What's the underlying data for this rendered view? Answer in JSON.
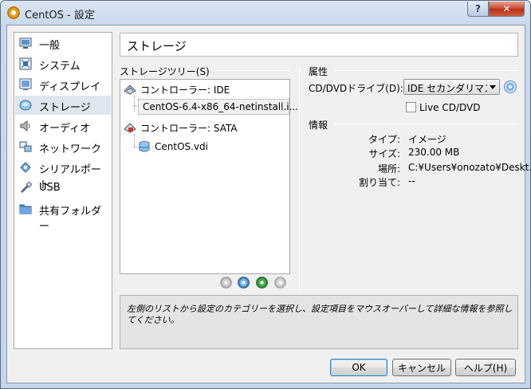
{
  "window": {
    "title": "CentOS - 設定",
    "help_button": "?",
    "close_button": "✕"
  },
  "nav": {
    "items": [
      {
        "label": "一般",
        "icon": "general-icon"
      },
      {
        "label": "システム",
        "icon": "system-icon"
      },
      {
        "label": "ディスプレイ",
        "icon": "display-icon"
      },
      {
        "label": "ストレージ",
        "icon": "storage-icon",
        "selected": true
      },
      {
        "label": "オーディオ",
        "icon": "audio-icon"
      },
      {
        "label": "ネットワーク",
        "icon": "network-icon"
      },
      {
        "label": "シリアルポート",
        "icon": "serial-port-icon"
      },
      {
        "label": "USB",
        "icon": "usb-icon"
      },
      {
        "label": "共有フォルダー",
        "icon": "shared-folder-icon"
      }
    ]
  },
  "page": {
    "header": "ストレージ"
  },
  "storage_tree": {
    "title": "ストレージツリー(S)",
    "controllers": [
      {
        "label": "コントローラー: IDE",
        "icon": "ide-controller-icon",
        "attachments": [
          {
            "label": "CentOS-6.4-x86_64-netinstall.i...",
            "icon": "optical-disc-icon",
            "selected": true
          }
        ]
      },
      {
        "label": "コントローラー: SATA",
        "icon": "sata-controller-icon",
        "attachments": [
          {
            "label": "CentOS.vdi",
            "icon": "hard-disk-icon"
          }
        ]
      }
    ],
    "toolbar_icons": [
      "add-attachment-icon",
      "add-cd-icon",
      "add-controller-icon",
      "remove-icon"
    ]
  },
  "attributes": {
    "title": "属性",
    "drive_label": "CD/DVDドライブ(D):",
    "drive_value": "IDE セカンダリマスター",
    "live_cd_label": "Live CD/DVD",
    "live_cd_checked": false
  },
  "info": {
    "title": "情報",
    "type_label": "タイプ:",
    "type_value": "イメージ",
    "size_label": "サイズ:",
    "size_value": "230.00 MB",
    "location_label": "場所:",
    "location_value": "C:¥Users¥onozato¥Deskt…",
    "attached_label": "割り当て:",
    "attached_value": "--"
  },
  "description": "左側のリストから設定のカテゴリーを選択し、設定項目をマウスオーバーして詳細な情報を参照してください。",
  "buttons": {
    "ok": "OK",
    "cancel": "キャンセル",
    "help": "ヘルプ(H)"
  }
}
